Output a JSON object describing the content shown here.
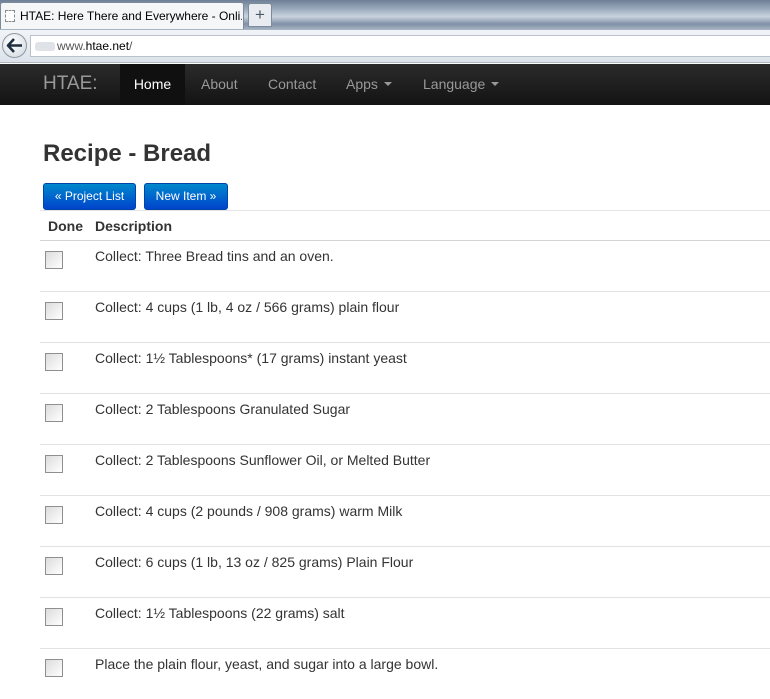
{
  "browser": {
    "tab_title": "HTAE: Here There and Everywhere - Onli...",
    "new_tab_symbol": "+",
    "url_prefix": "www.",
    "url_host": "htae.net",
    "url_suffix": "/"
  },
  "navbar": {
    "brand": "HTAE:",
    "items": [
      {
        "label": "Home",
        "active": true
      },
      {
        "label": "About"
      },
      {
        "label": "Contact"
      },
      {
        "label": "Apps",
        "dropdown": true
      },
      {
        "label": "Language",
        "dropdown": true
      }
    ]
  },
  "page": {
    "title": "Recipe - Bread",
    "project_list_button": "« Project List",
    "new_item_button": "New Item »",
    "table": {
      "headers": {
        "done": "Done",
        "description": "Description"
      },
      "rows": [
        {
          "done": false,
          "description": "Collect: Three Bread tins and an oven."
        },
        {
          "done": false,
          "description": "Collect: 4 cups (1 lb, 4 oz / 566 grams) plain flour"
        },
        {
          "done": false,
          "description": "Collect: 1½ Tablespoons* (17 grams) instant yeast"
        },
        {
          "done": false,
          "description": "Collect: 2 Tablespoons Granulated Sugar"
        },
        {
          "done": false,
          "description": "Collect: 2 Tablespoons Sunflower Oil, or Melted Butter"
        },
        {
          "done": false,
          "description": "Collect: 4 cups (2 pounds / 908 grams) warm Milk"
        },
        {
          "done": false,
          "description": "Collect: 6 cups (1 lb, 13 oz / 825 grams) Plain Flour"
        },
        {
          "done": false,
          "description": "Collect: 1½ Tablespoons (22 grams) salt"
        },
        {
          "done": false,
          "description": "Place the plain flour, yeast, and sugar into a large bowl."
        }
      ]
    }
  },
  "colors": {
    "navbar_bg": "#1b1b1b",
    "nav_text": "#999999",
    "nav_active_text": "#ffffff",
    "button_primary": "#0074cc",
    "title_text": "#333333"
  },
  "icons": {
    "back": "back-arrow-icon",
    "favicon": "page-favicon-icon",
    "checkbox": "checkbox-icon"
  }
}
